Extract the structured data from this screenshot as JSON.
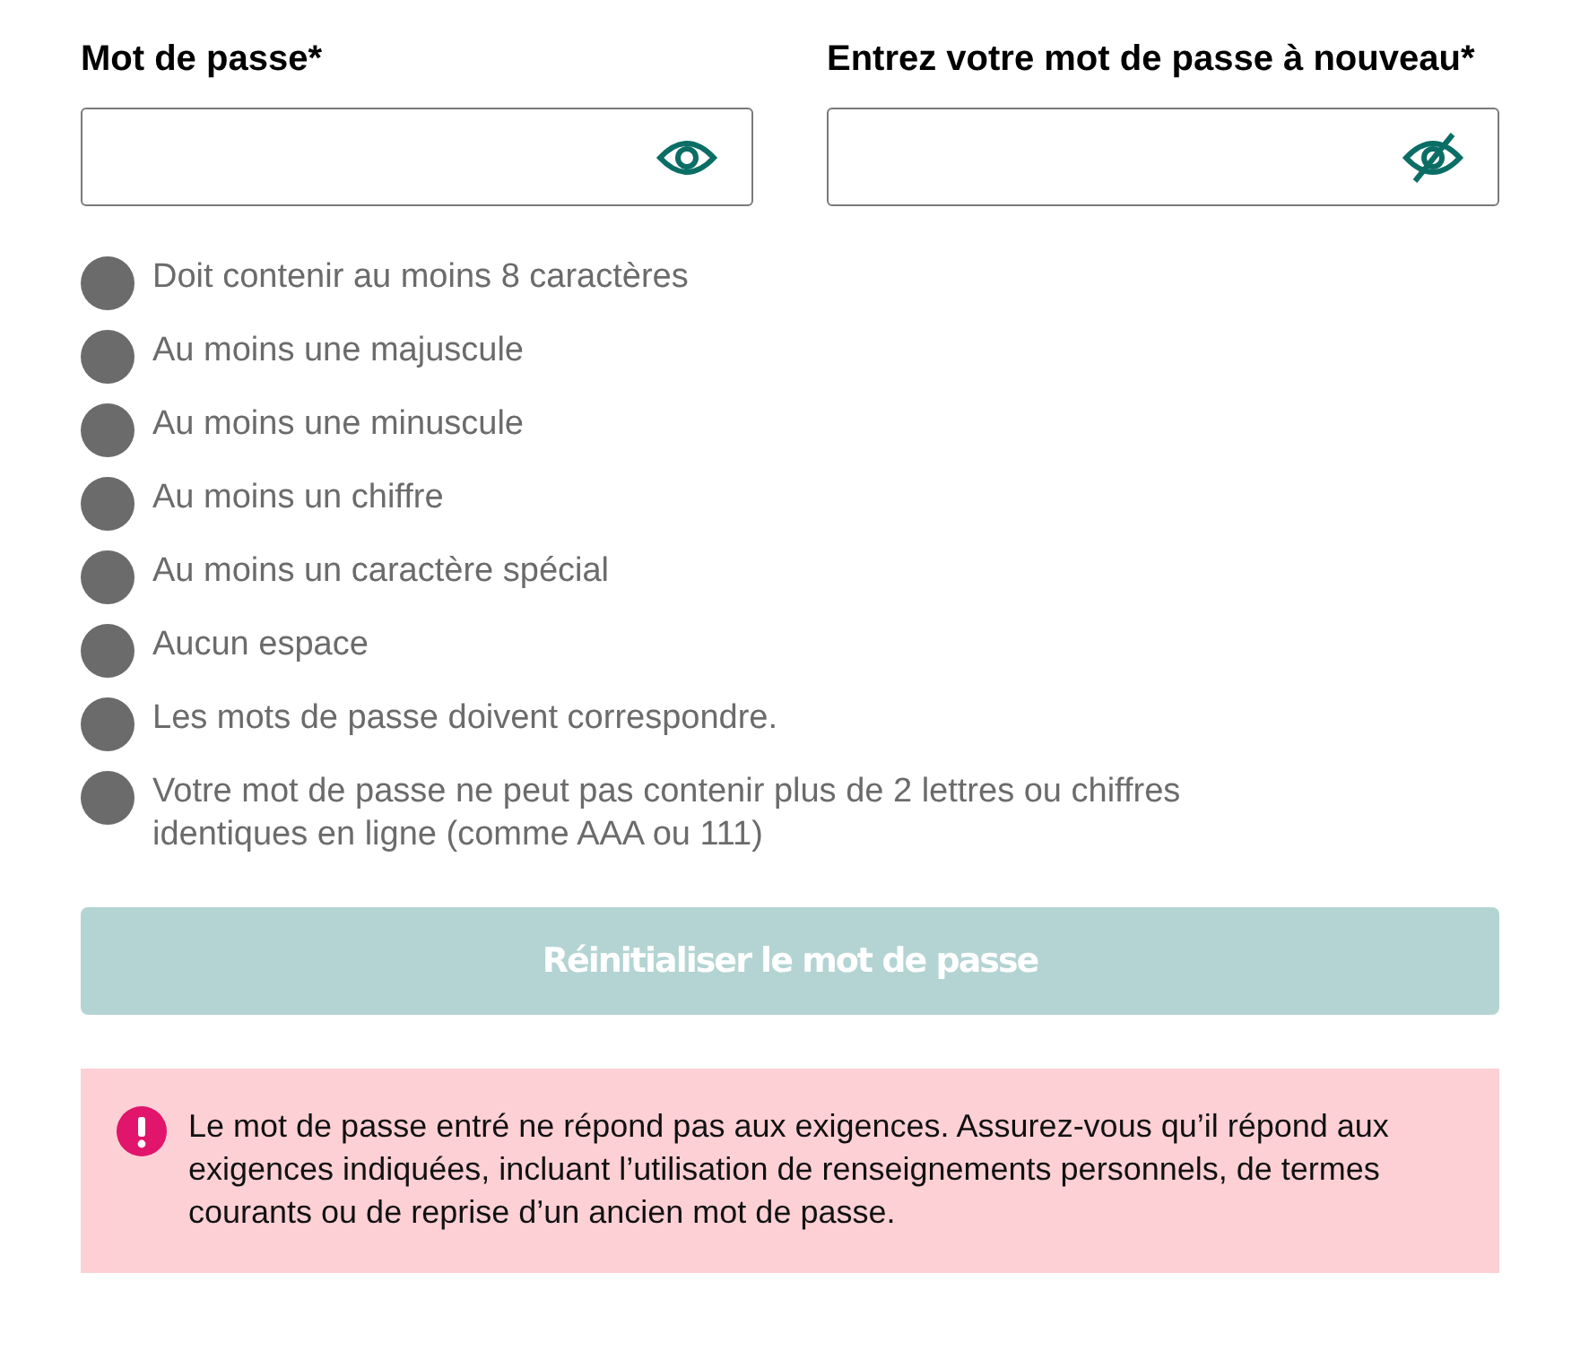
{
  "fields": [
    {
      "label": "Mot de passe*",
      "masked": false
    },
    {
      "label": "Entrez votre mot de passe à nouveau*",
      "masked": true
    }
  ],
  "requirements": [
    {
      "text": "Doit contenir au moins 8 caractères",
      "met": false
    },
    {
      "text": "Au moins une majuscule",
      "met": false
    },
    {
      "text": "Au moins une minuscule",
      "met": false
    },
    {
      "text": "Au moins un chiffre",
      "met": false
    },
    {
      "text": "Au moins un caractère spécial",
      "met": false
    },
    {
      "text": "Aucun espace",
      "met": false
    },
    {
      "text": "Les mots de passe doivent correspondre.",
      "met": false
    },
    {
      "text": "Votre mot de passe ne peut pas contenir plus de 2 lettres ou chiffres identiques en ligne (comme AAA ou 111)",
      "met": false
    }
  ],
  "submit_button": {
    "label": "Réinitialiser le mot de passe",
    "disabled": true
  },
  "error": {
    "message": "Le mot de passe entré ne répond pas aux exigences. Assurez-vous qu’il répond aux exigences indiquées, incluant l’utilisation de renseignements personnels, de termes courants ou de reprise d’un ancien mot de passe."
  }
}
